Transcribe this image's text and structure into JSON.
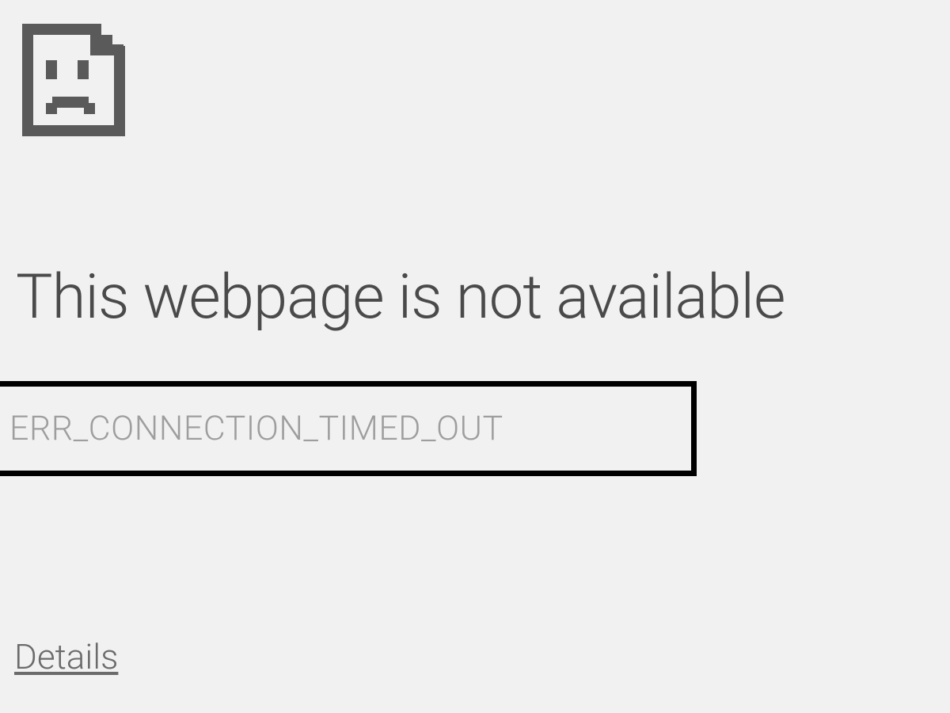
{
  "error": {
    "heading": "This webpage is not available",
    "code": "ERR_CONNECTION_TIMED_OUT",
    "details_label": "Details"
  }
}
